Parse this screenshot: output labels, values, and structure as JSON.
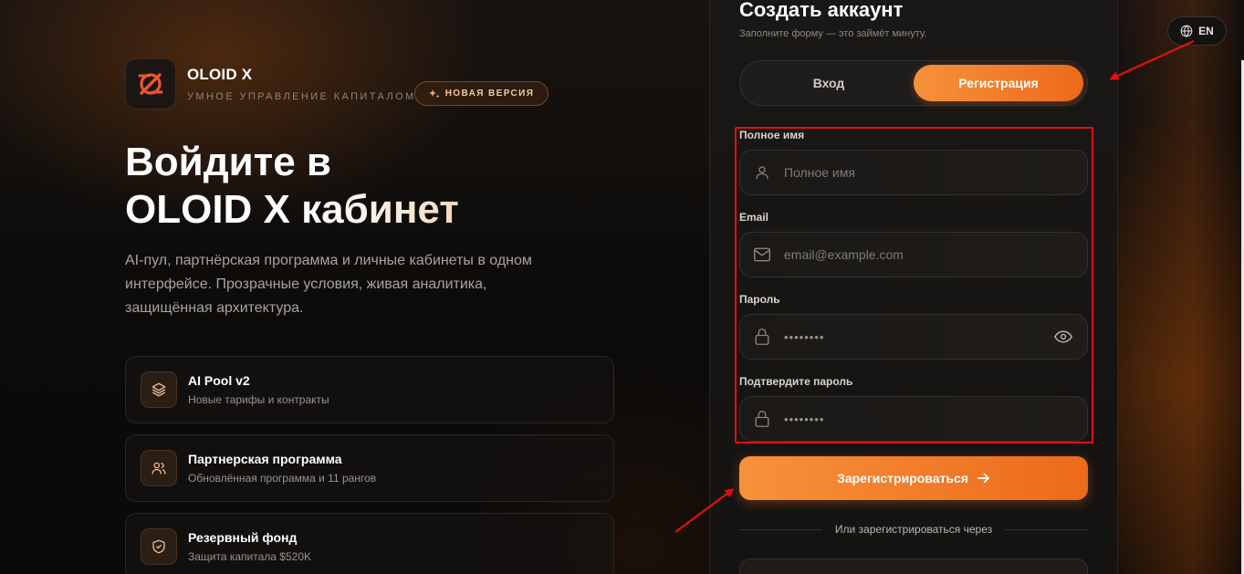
{
  "brand": {
    "name": "OLOID X",
    "tagline": "УМНОЕ УПРАВЛЕНИЕ КАПИТАЛОМ",
    "badge": "НОВАЯ ВЕРСИЯ"
  },
  "hero": {
    "title_line1": "Войдите в",
    "title_line2": "OLOID X кабинет",
    "description": "AI-пул, партнёрская программа и личные кабинеты в одном интерфейсе. Прозрачные условия, живая аналитика, защищённая архитектура."
  },
  "features": [
    {
      "title": "AI Pool v2",
      "subtitle": "Новые тарифы и контракты",
      "icon": "layers-icon"
    },
    {
      "title": "Партнерская программа",
      "subtitle": "Обновлённая программа и 11 рангов",
      "icon": "users-icon"
    },
    {
      "title": "Резервный фонд",
      "subtitle": "Защита капитала $520K",
      "icon": "shield-icon"
    }
  ],
  "form": {
    "title": "Создать аккаунт",
    "subtitle": "Заполните форму — это займёт минуту.",
    "tabs": [
      {
        "label": "Вход",
        "active": false
      },
      {
        "label": "Регистрация",
        "active": true
      }
    ],
    "fields": {
      "name": {
        "label": "Полное имя",
        "placeholder": "Полное имя"
      },
      "email": {
        "label": "Email",
        "placeholder": "email@example.com"
      },
      "password": {
        "label": "Пароль",
        "value": "••••••••"
      },
      "confirm": {
        "label": "Подтвердите пароль",
        "value": "••••••••"
      }
    },
    "submit_label": "Зарегистрироваться",
    "divider_text": "Или зарегистрироваться через"
  },
  "lang": {
    "label": "EN"
  },
  "colors": {
    "accent": "#f28030",
    "annotation": "#e01010"
  }
}
